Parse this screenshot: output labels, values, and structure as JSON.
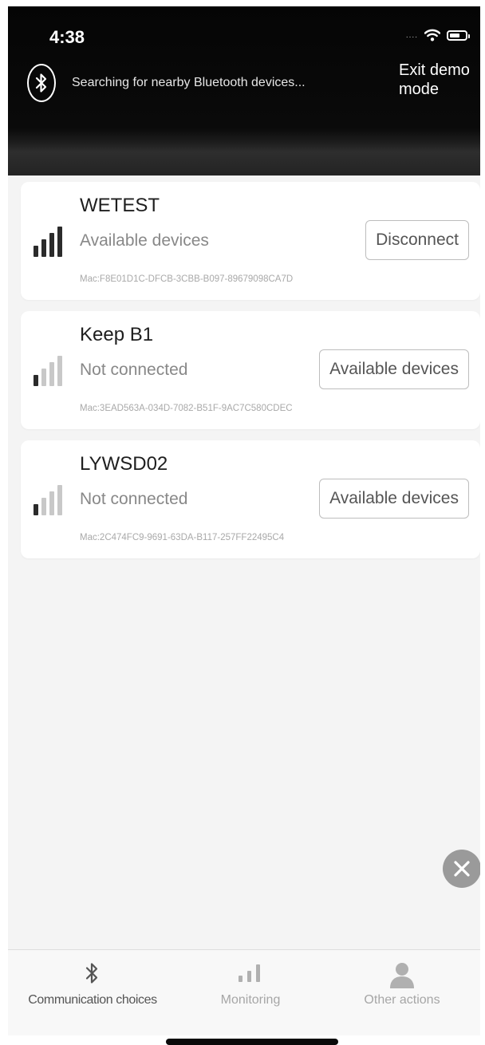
{
  "status_bar": {
    "time": "4:38",
    "signal_indicator": "....",
    "icons": [
      "wifi-icon",
      "battery-icon"
    ]
  },
  "header": {
    "bluetooth_icon": "bluetooth-icon",
    "search_text": "Searching for nearby Bluetooth devices...",
    "exit_demo_label": "Exit demo mode"
  },
  "devices": [
    {
      "name": "WETEST",
      "status": "Available devices",
      "mac": "Mac:F8E01D1C-DFCB-3CBB-B097-89679098CA7D",
      "button_label": "Disconnect",
      "signal_level": 4
    },
    {
      "name": "Keep B1",
      "status": "Not connected",
      "mac": "Mac:3EAD563A-034D-7082-B51F-9AC7C580CDEC",
      "button_label": "Available devices",
      "signal_level": 1
    },
    {
      "name": "LYWSD02",
      "status": "Not connected",
      "mac": "Mac:2C474FC9-9691-63DA-B117-257FF22495C4",
      "button_label": "Available devices",
      "signal_level": 1
    }
  ],
  "close_button_icon": "close-icon",
  "tab_bar": {
    "tabs": [
      {
        "label": "Communication choices",
        "icon": "bluetooth-icon",
        "active": true
      },
      {
        "label": "Monitoring",
        "icon": "signal-bars-icon",
        "active": false
      },
      {
        "label": "Other actions",
        "icon": "person-icon",
        "active": false
      }
    ]
  },
  "colors": {
    "header_bg": "#050505",
    "card_bg": "#ffffff",
    "page_bg": "#f4f4f4",
    "signal_active": "#2b2b2b",
    "signal_inactive": "#c8c8c8",
    "close_button_bg": "#9a9a9a"
  }
}
